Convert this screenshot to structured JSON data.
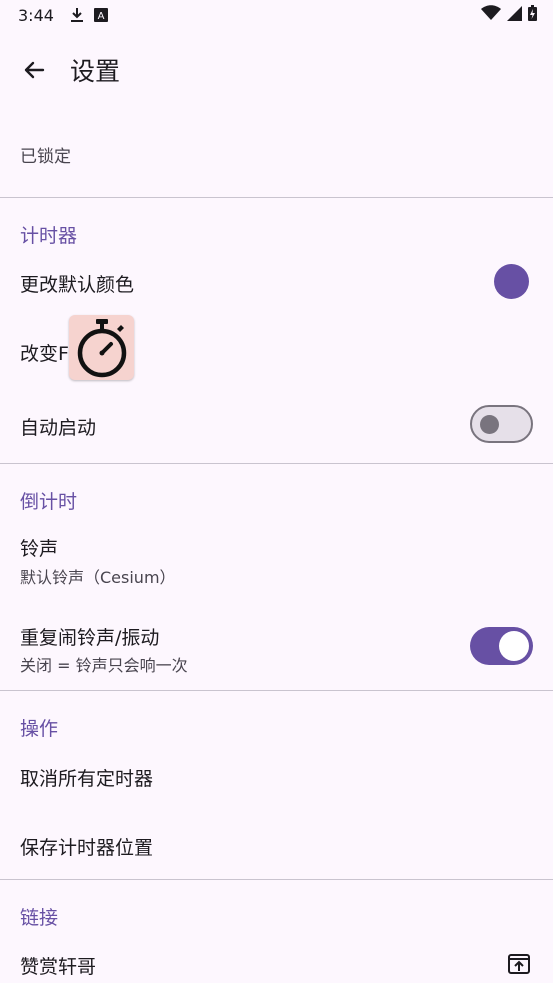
{
  "status_bar": {
    "time": "3:44",
    "icons": [
      "download-icon",
      "a-badge-icon",
      "wifi-icon",
      "signal-icon",
      "battery-charging-icon"
    ]
  },
  "app_bar": {
    "back_icon": "arrow-back-icon",
    "title": "设置"
  },
  "locked": {
    "label": "已锁定"
  },
  "timer_section": {
    "header": "计时器",
    "change_color": {
      "label": "更改默认颜色",
      "color": "#6750a4"
    },
    "change_icon": {
      "label": "改变F"
    },
    "auto_start": {
      "label": "自动启动",
      "enabled": false
    }
  },
  "countdown_section": {
    "header": "倒计时",
    "ringtone": {
      "label": "铃声",
      "summary": "默认铃声（Cesium）"
    },
    "repeat": {
      "label": "重复闹铃声/振动",
      "summary": "关闭 = 铃声只会响一次",
      "enabled": true
    }
  },
  "actions_section": {
    "header": "操作",
    "cancel_all": "取消所有定时器",
    "save_positions": "保存计时器位置"
  },
  "links_section": {
    "header": "链接",
    "donate": "赞赏轩哥",
    "donate_icon": "open-in-new-icon"
  },
  "colors": {
    "accent": "#6750a4",
    "background": "#fdf7fe",
    "overlay_bg": "#f6d3cf"
  }
}
